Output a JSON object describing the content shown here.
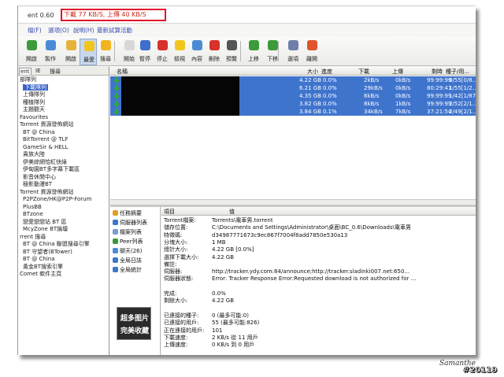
{
  "title": {
    "app": "ent 0.60",
    "speed": "下載 77 KB/S, 上傳 40 KB/S"
  },
  "menu": [
    "檔(F)",
    "選項(O)",
    "說明(H)",
    "最新試算活動"
  ],
  "toolbar": [
    {
      "label": "開啟",
      "icon": "open-icon",
      "color": "#3d9a3a"
    },
    {
      "label": "製作",
      "icon": "create-icon",
      "color": "#4b8bd6"
    },
    {
      "label": "開啟",
      "icon": "folder-icon",
      "color": "#e6b33a"
    },
    {
      "label": "最愛",
      "icon": "star-icon",
      "color": "#f1c61c"
    },
    {
      "label": "搜尋",
      "icon": "search-icon",
      "color": "#f0b41f"
    },
    {
      "label": "開始",
      "icon": "play-icon",
      "color": "#d8d8d8"
    },
    {
      "label": "暫停",
      "icon": "pause-icon",
      "color": "#3f6fca"
    },
    {
      "label": "停止",
      "icon": "stop-icon",
      "color": "#d7322b"
    },
    {
      "label": "檢視",
      "icon": "view-icon",
      "color": "#f1c61c"
    },
    {
      "label": "內容",
      "icon": "properties-icon",
      "color": "#4b8bd6"
    },
    {
      "label": "刪除",
      "icon": "delete-icon",
      "color": "#d7322b"
    },
    {
      "label": "預覽",
      "icon": "preview-icon",
      "color": "#555"
    },
    {
      "label": "上移",
      "icon": "up-icon",
      "color": "#3d9a3a"
    },
    {
      "label": "下移",
      "icon": "down-icon",
      "color": "#3d9a3a"
    },
    {
      "label": "選項",
      "icon": "options-icon",
      "color": "#6d7fa8"
    },
    {
      "label": "離開",
      "icon": "exit-icon",
      "color": "#e0542b"
    }
  ],
  "sidebar": {
    "tabs": [
      "ent",
      "IE",
      "搜尋"
    ],
    "items": [
      "部隊列",
      "下載隊列",
      "上傳隊列",
      "種植隊列",
      "主題觀天",
      "Favourites",
      "Torrent 資源發佈網站",
      "BT @ China",
      "BitTorrent @ TLF",
      "GameSir & HELL",
      "貴族大陸",
      "伊美綜網恰紅快綠",
      "伊甸園BT多字幕下載區",
      "影音休閒中心",
      "極影動漫BT",
      "Torrent 資源發佈網站",
      "P2PZone/HK@P2P-Forum",
      "PlusBB",
      "BTzone",
      "戀愛戀戀站 BT 區",
      "McyZone BT論壇",
      "rrent 搜尋",
      "BT @ China 聯盟搜尋引擎",
      "BT 守望者(BTower)",
      "BT @ China",
      "黃金BT搜索引擎",
      "Comet 軟件主頁"
    ]
  },
  "list": {
    "headers": [
      "名稱",
      "大小",
      "進度",
      "下載",
      "上傳",
      "剩時",
      "種子/用..."
    ],
    "rows": [
      {
        "size": "4.22 GB",
        "progress": "0.0%",
        "down": "2kB/s",
        "up": "0kB/s",
        "eta": "99:99:99",
        "seeds": "0/55[0/8..."
      },
      {
        "size": "6.21 GB",
        "progress": "0.0%",
        "down": "29kB/s",
        "up": "0kB/s",
        "eta": "80:29:41",
        "seeds": "1/55[1/2..."
      },
      {
        "size": "4.35 GB",
        "progress": "0.0%",
        "down": "6kB/s",
        "up": "0kB/s",
        "eta": "99:99:99",
        "seeds": "1/42[1/87]"
      },
      {
        "size": "3.82 GB",
        "progress": "0.0%",
        "down": "8kB/s",
        "up": "1kB/s",
        "eta": "99:99:99",
        "seeds": "2/52[2/1..."
      },
      {
        "size": "3.84 GB",
        "progress": "0.1%",
        "down": "34kB/s",
        "up": "7kB/s",
        "eta": "37:21:54",
        "seeds": "2/49[2/1..."
      }
    ]
  },
  "detail_tabs": [
    "任務摘要",
    "伺服器列表",
    "檔案列表",
    "Peer列表",
    "聊天(26)",
    "全局日誌",
    "全局統計"
  ],
  "promo": [
    "超多图片",
    "完美收藏"
  ],
  "details": {
    "headers": [
      "項目",
      "值"
    ],
    "rows": [
      {
        "k": "Torrent檔案:",
        "v": "Torrents\\電車男.torrent"
      },
      {
        "k": "儲存位置:",
        "v": "C:\\Documents and Settings\\Administrator\\桌面\\BC_0.6\\Downloads\\電車男"
      },
      {
        "k": "特徵碼:",
        "v": "d34987771673c9ec867f7004f8add7850e530a13"
      },
      {
        "k": "分塊大小:",
        "v": "1 MB"
      },
      {
        "k": "總計大小:",
        "v": "4.22 GB [0.0%]"
      },
      {
        "k": "選擇下載大小:",
        "v": "4.22 GB"
      },
      {
        "k": "備註:",
        "v": ""
      },
      {
        "k": "伺服器:",
        "v": "http://tracker.ydy.com:84/announce;http://tracker.sladinki007.net:650..."
      },
      {
        "k": "伺服器狀態:",
        "v": "Error: Tracker Response Error:Requested download is not authorized for ..."
      },
      {
        "k": "",
        "v": ""
      },
      {
        "k": "完成:",
        "v": "0.0%"
      },
      {
        "k": "剩餘大小:",
        "v": "4.22 GB"
      },
      {
        "k": "",
        "v": ""
      },
      {
        "k": "已連接的種子:",
        "v": "0 (最多可能:0)"
      },
      {
        "k": "已連接的用戶:",
        "v": "55 (最多可能:826)"
      },
      {
        "k": "正在連接的用戶:",
        "v": "101"
      },
      {
        "k": "下載速度:",
        "v": "2 KB/s 從 11 用戶"
      },
      {
        "k": "上傳速度:",
        "v": "0 KB/s 到 0 用戶"
      }
    ]
  },
  "signature": "Samanthe",
  "watermark": "#20119"
}
